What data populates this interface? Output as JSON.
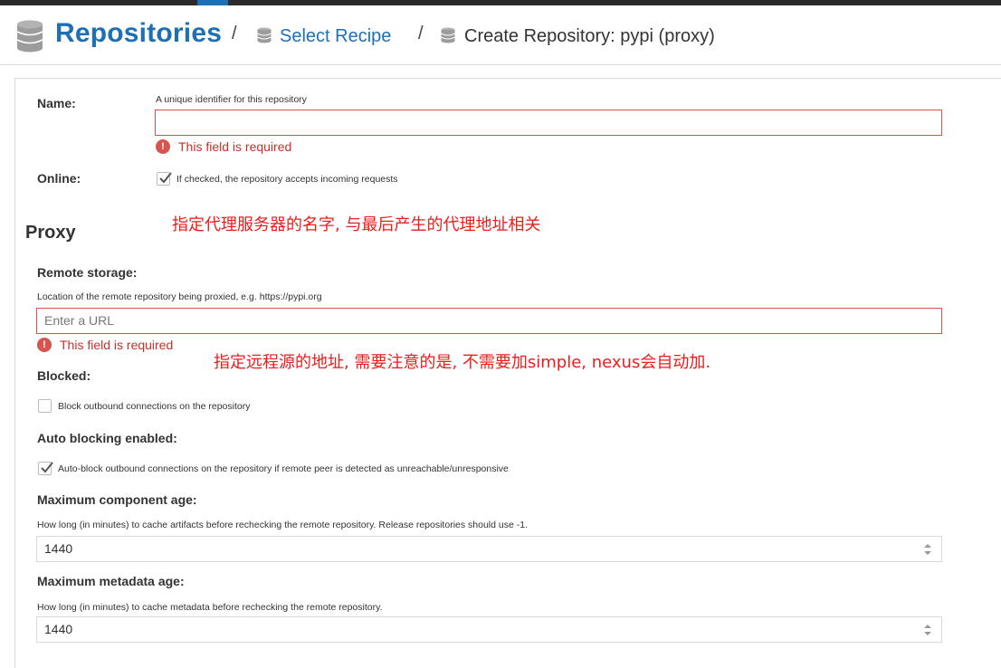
{
  "breadcrumb": {
    "root": "Repositories",
    "separator": "/",
    "link": "Select Recipe",
    "current": "Create Repository: pypi (proxy)"
  },
  "form": {
    "name": {
      "label": "Name:",
      "help": "A unique identifier for this repository",
      "value": "",
      "error": "This field is required"
    },
    "online": {
      "label": "Online:",
      "checked": true,
      "text": "If checked, the repository accepts incoming requests"
    },
    "proxy": {
      "title": "Proxy",
      "remote_storage": {
        "label": "Remote storage:",
        "help": "Location of the remote repository being proxied, e.g. https://pypi.org",
        "placeholder": "Enter a URL",
        "error": "This field is required"
      },
      "blocked": {
        "label": "Blocked:",
        "checked": false,
        "text": "Block outbound connections on the repository"
      },
      "auto_blocking": {
        "label": "Auto blocking enabled:",
        "checked": true,
        "text": "Auto-block outbound connections on the repository if remote peer is detected as unreachable/unresponsive"
      },
      "max_component_age": {
        "label": "Maximum component age:",
        "help": "How long (in minutes) to cache artifacts before rechecking the remote repository. Release repositories should use -1.",
        "value": "1440"
      },
      "max_metadata_age": {
        "label": "Maximum metadata age:",
        "help": "How long (in minutes) to cache metadata before rechecking the remote repository.",
        "value": "1440"
      }
    }
  },
  "annotations": {
    "name_note": "指定代理服务器的名字, 与最后产生的代理地址相关",
    "url_note": "指定远程源的地址, 需要注意的是, 不需要加simple, nexus会自动加."
  },
  "icons": {
    "repository": "database-icon",
    "error": "exclamation-circle-icon",
    "checkmark": "checkmark-icon",
    "spinner": "spinner-arrows-icon"
  },
  "colors": {
    "accent": "#1f6fb5",
    "error": "#d9534f",
    "annotation": "#ee1c1c"
  }
}
